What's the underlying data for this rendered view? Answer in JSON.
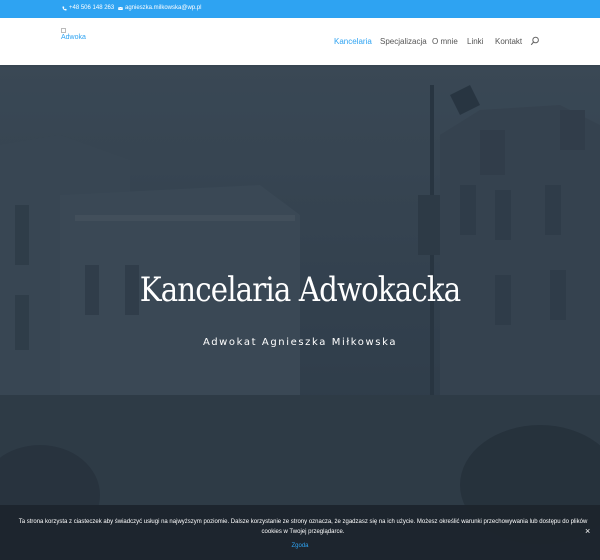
{
  "topbar": {
    "phone": "+48 506 148 263",
    "email": "agnieszka.milkowska@wp.pl",
    "phone_icon": "phone-icon",
    "email_icon": "envelope-icon",
    "background": "#2ea3f2"
  },
  "header": {
    "logo_alt": "Adwoka",
    "nav": [
      {
        "label": "Kancelaria",
        "active": true
      },
      {
        "label": "Specjalizacja",
        "active": false
      },
      {
        "label": "O mnie",
        "active": false
      },
      {
        "label": "Linki",
        "active": false
      },
      {
        "label": "Kontakt",
        "active": false
      }
    ],
    "search_icon": "search-icon",
    "accent": "#2ea3f2"
  },
  "hero": {
    "title": "Kancelaria Adwokacka",
    "subtitle": "Adwokat Agnieszka Miłkowska"
  },
  "cookie": {
    "message": "Ta strona korzysta z ciasteczek aby świadczyć usługi na najwyższym poziomie. Dalsze korzystanie ze strony oznacza, że zgadzasz się na ich użycie. Możesz określić warunki przechowywania lub dostępu do plików cookies w Twojej przeglądarce.",
    "accept_label": "Zgoda",
    "close_label": "×"
  }
}
